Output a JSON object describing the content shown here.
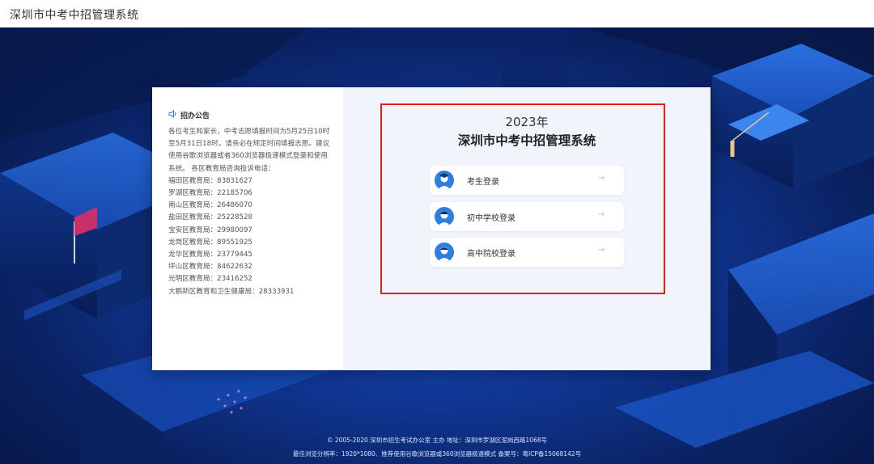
{
  "header": {
    "site_title": "深圳市中考中招管理系统"
  },
  "notice": {
    "title": "招办公告",
    "intro": "各位考生和家长，中考志愿填报时间为5月25日10时至5月31日18时，请务必在规定时间填报志愿。建议使用谷歌浏览器或者360浏览器极速模式登录和使用系统。 各区教育局咨询投诉电话：",
    "contacts": [
      "福田区教育局：83831627",
      "罗湖区教育局：22185706",
      "南山区教育局：26486070",
      "盐田区教育局：25228528",
      "宝安区教育局：29980097",
      "龙岗区教育局：89551925",
      "龙华区教育局：23779445",
      "坪山区教育局：84622632",
      "光明区教育局：23416252",
      "大鹏新区教育和卫生健康局：28333931"
    ]
  },
  "login": {
    "year": "2023年",
    "system_title": "深圳市中考中招管理系统",
    "buttons": [
      {
        "label": "考生登录",
        "arrow": "→"
      },
      {
        "label": "初中学校登录",
        "arrow": "→"
      },
      {
        "label": "高中院校登录",
        "arrow": "→"
      }
    ]
  },
  "footer": {
    "line1": "© 2005-2020 深圳市招生考试办公室 主办 地址：深圳市罗湖区泥岗西路1068号",
    "line2": "最佳浏览分辨率：1920*1080、推荐使用谷歌浏览器或360浏览器极速模式 备案号：粤ICP备15068142号"
  },
  "colors": {
    "highlight_border": "#e02020",
    "accent": "#2e7de0",
    "background": "#11399a"
  }
}
